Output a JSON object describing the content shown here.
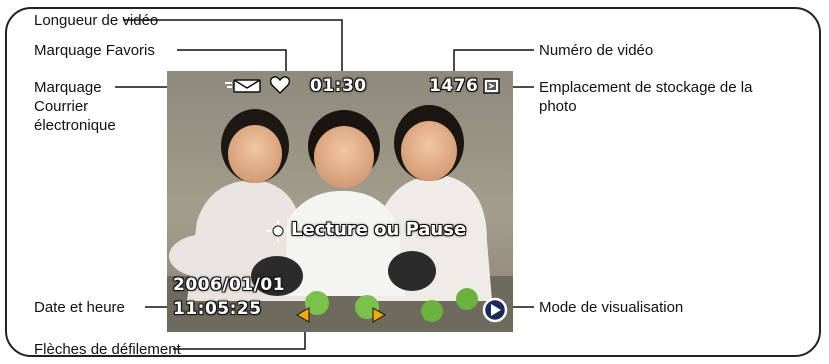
{
  "callouts": {
    "video_length": "Longueur de vidéo",
    "favorite_tag": "Marquage Favoris",
    "email_tag": "Marquage Courrier électronique",
    "video_number": "Numéro de vidéo",
    "storage_location": "Emplacement de stockage de la photo",
    "date_time": "Date et heure",
    "review_mode": "Mode de visualisation",
    "scroll_arrows": "Flèches de défilement"
  },
  "screen": {
    "video_length_value": "01:30",
    "video_number_value": "1476",
    "play_pause_label": "Lecture ou Pause",
    "date_value": "2006/01/01",
    "time_value": "11:05:25"
  },
  "icons": [
    "email-tag-icon",
    "heart-icon",
    "storage-card-icon",
    "joystick-icon",
    "play-mode-icon",
    "left-arrow-icon",
    "right-arrow-icon"
  ],
  "colors": {
    "arrow": "#f5a800",
    "osd_text": "#ffffff",
    "border": "#222222"
  }
}
